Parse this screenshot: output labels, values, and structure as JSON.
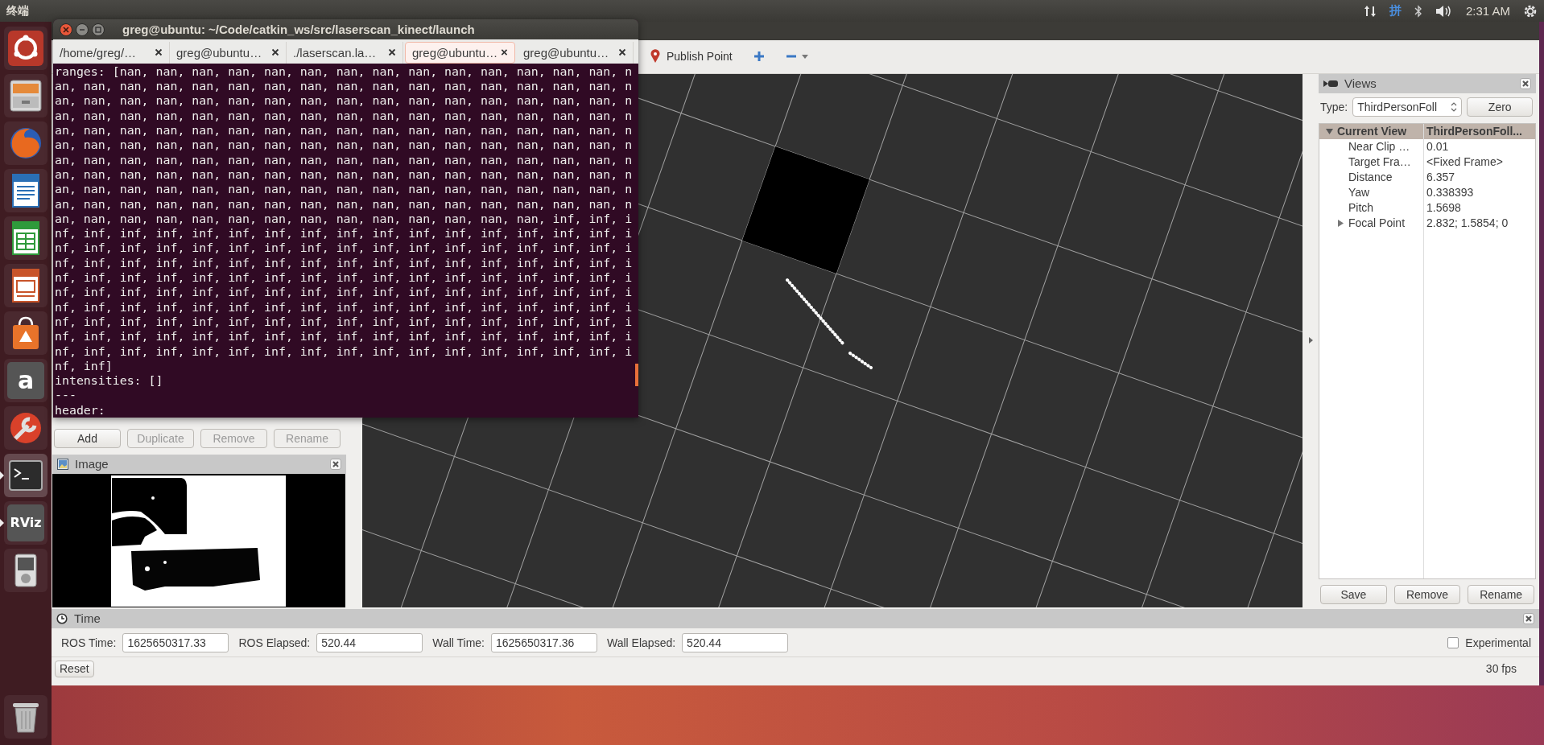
{
  "top_panel": {
    "title": "终端",
    "input_method": "拼",
    "clock": "2:31 AM"
  },
  "launcher": [
    {
      "kind": "ring",
      "running": false
    },
    {
      "kind": "drawer",
      "running": false
    },
    {
      "kind": "globe",
      "running": false
    },
    {
      "kind": "document",
      "running": false
    },
    {
      "kind": "spreadsheet",
      "running": false
    },
    {
      "kind": "presentation",
      "running": false
    },
    {
      "kind": "bag",
      "running": false
    },
    {
      "kind": "letter",
      "label": "a",
      "running": false
    },
    {
      "kind": "wrench",
      "running": false
    },
    {
      "kind": "terminal",
      "running": true
    },
    {
      "kind": "letter",
      "label": "RViz",
      "running": true
    },
    {
      "kind": "player",
      "running": false
    }
  ],
  "trash": {
    "kind": "trash"
  },
  "rviz": {
    "toolbar": [
      {
        "kind": "pin",
        "label": "Publish Point"
      },
      {
        "kind": "plus"
      },
      {
        "kind": "minus"
      }
    ],
    "display_buttons": [
      {
        "label": "Add",
        "disabled": false
      },
      {
        "label": "Duplicate",
        "disabled": true
      },
      {
        "label": "Remove",
        "disabled": true
      },
      {
        "label": "Rename",
        "disabled": true
      }
    ],
    "image_panel": {
      "title": "Image"
    },
    "views": {
      "title": "Views",
      "type_label": "Type:",
      "type_value": "ThirdPersonFoll",
      "zero": "Zero",
      "header": {
        "name": "Current View",
        "value": "ThirdPersonFoll...",
        "expanded": true
      },
      "properties": [
        {
          "kind": "value",
          "name": "Near Clip …",
          "value": "0.01"
        },
        {
          "kind": "value",
          "name": "Target Fra…",
          "value": "<Fixed Frame>"
        },
        {
          "kind": "value",
          "name": "Distance",
          "value": "6.357"
        },
        {
          "kind": "value",
          "name": "Yaw",
          "value": "0.338393"
        },
        {
          "kind": "value",
          "name": "Pitch",
          "value": "1.5698"
        },
        {
          "kind": "group",
          "name": "Focal Point",
          "value": "2.832; 1.5854; 0",
          "expanded": false
        }
      ],
      "buttons": [
        "Save",
        "Remove",
        "Rename"
      ]
    },
    "time": {
      "title": "Time",
      "fields": [
        {
          "label": "ROS Time:",
          "value": "1625650317.33"
        },
        {
          "label": "ROS Elapsed:",
          "value": "520.44"
        },
        {
          "label": "Wall Time:",
          "value": "1625650317.36"
        },
        {
          "label": "Wall Elapsed:",
          "value": "520.44"
        }
      ],
      "experimental": {
        "label": "Experimental",
        "checked": false
      },
      "reset": "Reset",
      "fps": "30 fps"
    }
  },
  "terminal": {
    "title": "greg@ubuntu: ~/Code/catkin_ws/src/laserscan_kinect/launch",
    "tabs": [
      {
        "label": "/home/greg/…",
        "selected": false
      },
      {
        "label": "greg@ubuntu…",
        "selected": false
      },
      {
        "label": "./laserscan.la…",
        "selected": false
      },
      {
        "label": "greg@ubuntu…",
        "selected": true
      },
      {
        "label": "greg@ubuntu…",
        "selected": false
      }
    ],
    "lines": [
      "ranges: [nan, nan, nan, nan, nan, nan, nan, nan, nan, nan, nan, nan, nan, nan, n",
      "an, nan, nan, nan, nan, nan, nan, nan, nan, nan, nan, nan, nan, nan, nan, nan, n",
      "an, nan, nan, nan, nan, nan, nan, nan, nan, nan, nan, nan, nan, nan, nan, nan, n",
      "an, nan, nan, nan, nan, nan, nan, nan, nan, nan, nan, nan, nan, nan, nan, nan, n",
      "an, nan, nan, nan, nan, nan, nan, nan, nan, nan, nan, nan, nan, nan, nan, nan, n",
      "an, nan, nan, nan, nan, nan, nan, nan, nan, nan, nan, nan, nan, nan, nan, nan, n",
      "an, nan, nan, nan, nan, nan, nan, nan, nan, nan, nan, nan, nan, nan, nan, nan, n",
      "an, nan, nan, nan, nan, nan, nan, nan, nan, nan, nan, nan, nan, nan, nan, nan, n",
      "an, nan, nan, nan, nan, nan, nan, nan, nan, nan, nan, nan, nan, nan, nan, nan, n",
      "an, nan, nan, nan, nan, nan, nan, nan, nan, nan, nan, nan, nan, nan, nan, nan, n",
      "an, nan, nan, nan, nan, nan, nan, nan, nan, nan, nan, nan, nan, nan, inf, inf, i",
      "nf, inf, inf, inf, inf, inf, inf, inf, inf, inf, inf, inf, inf, inf, inf, inf, i",
      "nf, inf, inf, inf, inf, inf, inf, inf, inf, inf, inf, inf, inf, inf, inf, inf, i",
      "nf, inf, inf, inf, inf, inf, inf, inf, inf, inf, inf, inf, inf, inf, inf, inf, i",
      "nf, inf, inf, inf, inf, inf, inf, inf, inf, inf, inf, inf, inf, inf, inf, inf, i",
      "nf, inf, inf, inf, inf, inf, inf, inf, inf, inf, inf, inf, inf, inf, inf, inf, i",
      "nf, inf, inf, inf, inf, inf, inf, inf, inf, inf, inf, inf, inf, inf, inf, inf, i",
      "nf, inf, inf, inf, inf, inf, inf, inf, inf, inf, inf, inf, inf, inf, inf, inf, i",
      "nf, inf, inf, inf, inf, inf, inf, inf, inf, inf, inf, inf, inf, inf, inf, inf, i",
      "nf, inf, inf, inf, inf, inf, inf, inf, inf, inf, inf, inf, inf, inf, inf, inf, i",
      "nf, inf]",
      "intensities: []",
      "---",
      "header:"
    ]
  }
}
